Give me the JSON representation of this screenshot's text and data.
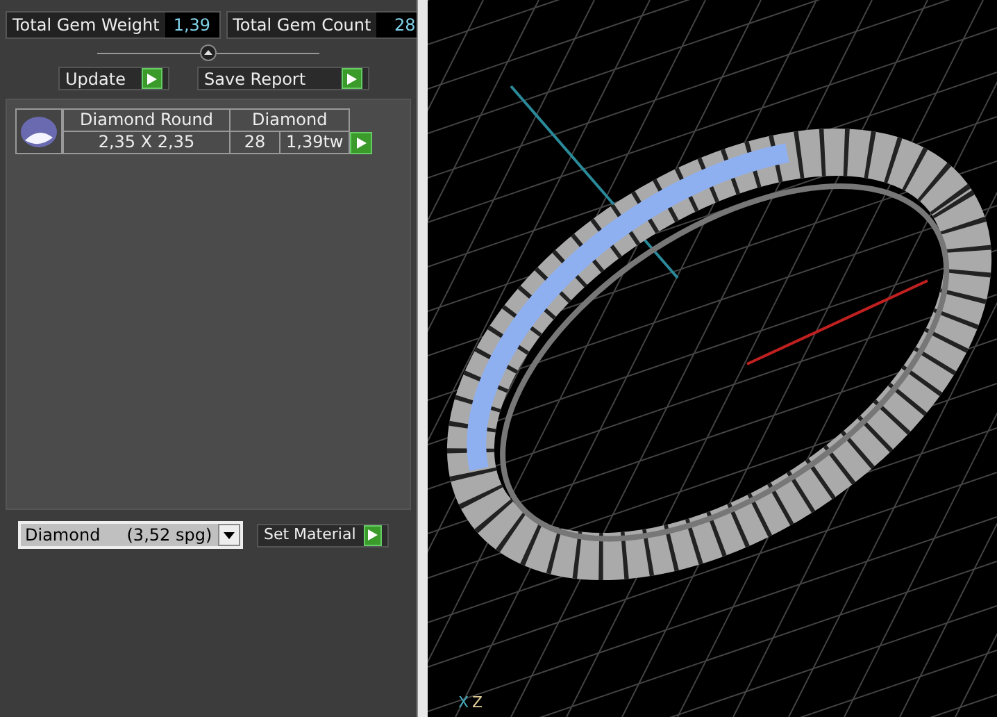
{
  "stats": [
    {
      "label": "Total Gem Weight",
      "value": "1,39"
    },
    {
      "label": "Total Gem Count",
      "value": "28"
    }
  ],
  "buttons": [
    {
      "label": "Update"
    },
    {
      "label": "Save Report"
    }
  ],
  "gems": [
    {
      "name": "Diamond Round",
      "material": "Diamond",
      "size": "2,35 X 2,35",
      "count": "28",
      "weight": "1,39tw"
    }
  ],
  "material_select": {
    "value": "Diamond     (3,52 spg)"
  },
  "set_material_button": {
    "label": "Set Material"
  },
  "viewport": {
    "axis_labels": [
      "X",
      "Z"
    ]
  }
}
